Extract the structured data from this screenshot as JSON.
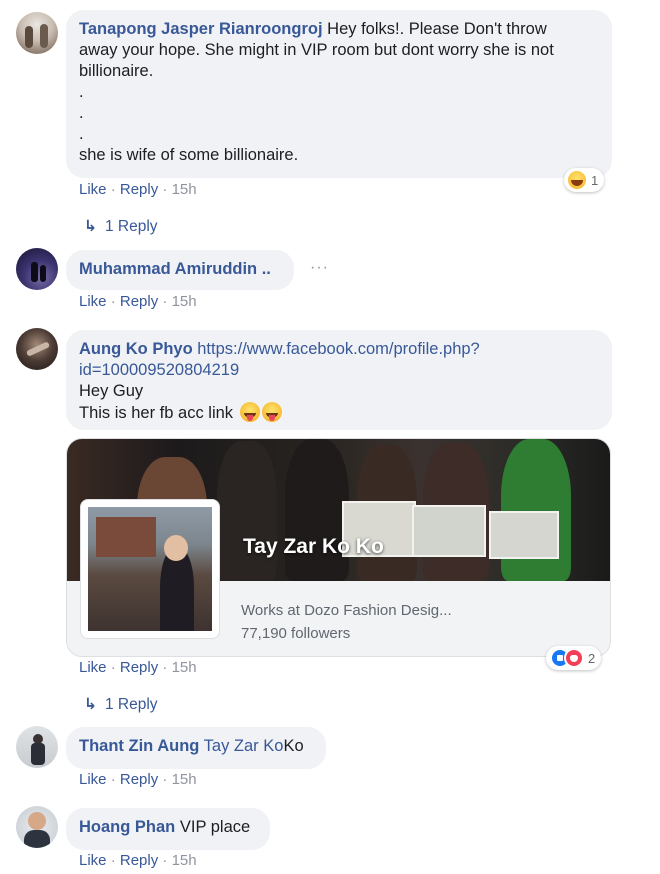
{
  "comments": [
    {
      "author": "Tanapong Jasper Rianroongroj",
      "text_lines": [
        "Hey folks!. Please Don't throw",
        "away your hope. She might in VIP room but dont worry she is not",
        "billionaire.",
        ".",
        ".",
        ".",
        "she is wife of some billionaire."
      ],
      "like": "Like",
      "reply": "Reply",
      "time": "15h",
      "reaction_count": "1",
      "reaction_icon": "laughing-emoji-icon",
      "replies_link": "1 Reply"
    },
    {
      "author": "Muhammad Amiruddin ..",
      "like": "Like",
      "reply": "Reply",
      "time": "15h"
    },
    {
      "author": "Aung Ko Phyo",
      "link_text_1": "https://www.facebook.com/profile.php?",
      "link_text_2": "id=100009520804219",
      "text_line_1": "Hey Guy",
      "text_line_2": "This is her fb acc link",
      "like": "Like",
      "reply": "Reply",
      "time": "15h",
      "reaction_count": "2",
      "replies_link": "1 Reply",
      "preview": {
        "title": "Tay Zar Ko Ko",
        "subtitle": "Works at Dozo Fashion Desig...",
        "followers": "77,190 followers"
      }
    },
    {
      "author": "Thant Zin Aung",
      "tag": "Tay Zar Ko",
      "text": "Ko",
      "like": "Like",
      "reply": "Reply",
      "time": "15h"
    },
    {
      "author": "Hoang Phan",
      "text": "VIP place",
      "like": "Like",
      "reply": "Reply",
      "time": "15h"
    }
  ],
  "separator": "·",
  "colors": {
    "bubble": "#f0f2f5",
    "link": "#385898",
    "meta": "#90949c",
    "like_reaction": "#1877f2",
    "love_reaction": "#f33e58"
  }
}
